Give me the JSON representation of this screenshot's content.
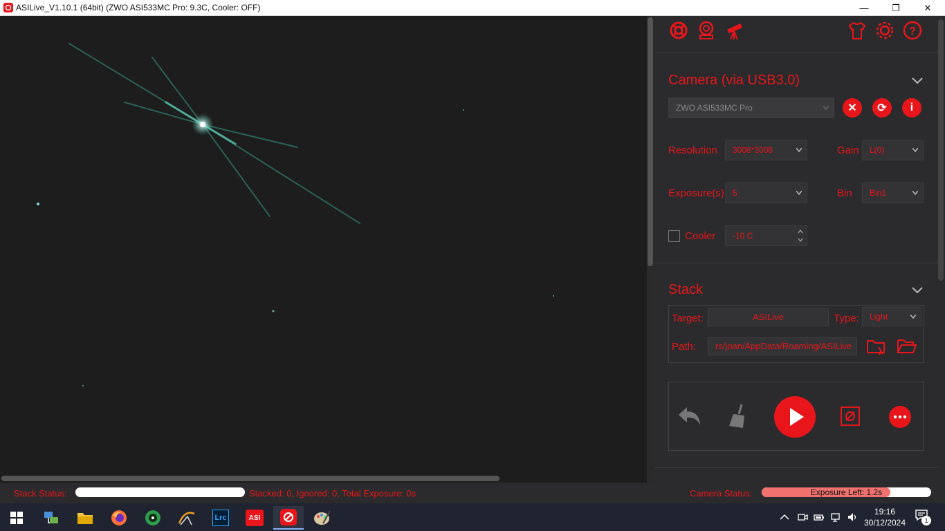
{
  "window": {
    "title": "ASILive_V1.10.1 (64bit)  (ZWO ASI533MC Pro: 9.3C, Cooler: OFF)",
    "min_glyph": "—",
    "max_glyph": "❐",
    "close_glyph": "✕"
  },
  "toolbar": {
    "icons": [
      "lifebuoy-icon",
      "camera-device-icon",
      "telescope-icon",
      "shirt-icon",
      "gear-icon",
      "help-icon"
    ]
  },
  "camera": {
    "section_title": "Camera (via USB3.0)",
    "device": "ZWO ASI533MC Pro",
    "resolution_label": "Resolution",
    "resolution_value": "3008*3008",
    "gain_label": "Gain",
    "gain_value": "L(0)",
    "exposure_label": "Exposure(s)",
    "exposure_value": "5",
    "bin_label": "Bin",
    "bin_value": "Bin1",
    "cooler_label": "Cooler",
    "cooler_checked": false,
    "cooler_value": "-10 C",
    "disconnect_glyph": "✕",
    "refresh_glyph": "⟳",
    "info_glyph": "i"
  },
  "stack": {
    "section_title": "Stack",
    "target_label": "Target:",
    "target_value": "ASILive",
    "type_label": "Type:",
    "type_value": "Light",
    "path_label": "Path:",
    "path_value": "rs/joan/AppData/Roaming/ASILive"
  },
  "status": {
    "stack_status_label": "Stack Status:",
    "stack_progress": 0,
    "stack_info": "Stacked: 0, Ignored: 0, Total Exposure: 0s",
    "camera_status_label": "Camera Status:",
    "camera_progress": 0.76,
    "camera_progress_text": "Exposure Left: 1.2s"
  },
  "colors": {
    "accent": "#e8161b",
    "panel_bg": "#2b2b2d"
  },
  "taskbar": {
    "apps": [
      "network-icon",
      "file-explorer-icon",
      "firefox-icon",
      "stellarium-icon",
      "sharpcap-icon",
      "lightroom-icon",
      "asi-studio-icon",
      "asilive-icon",
      "paint-icon"
    ],
    "lrc_text": "Lrc",
    "asi_text": "ASI",
    "time": "19:16",
    "date": "30/12/2024",
    "notification_count": "1"
  }
}
